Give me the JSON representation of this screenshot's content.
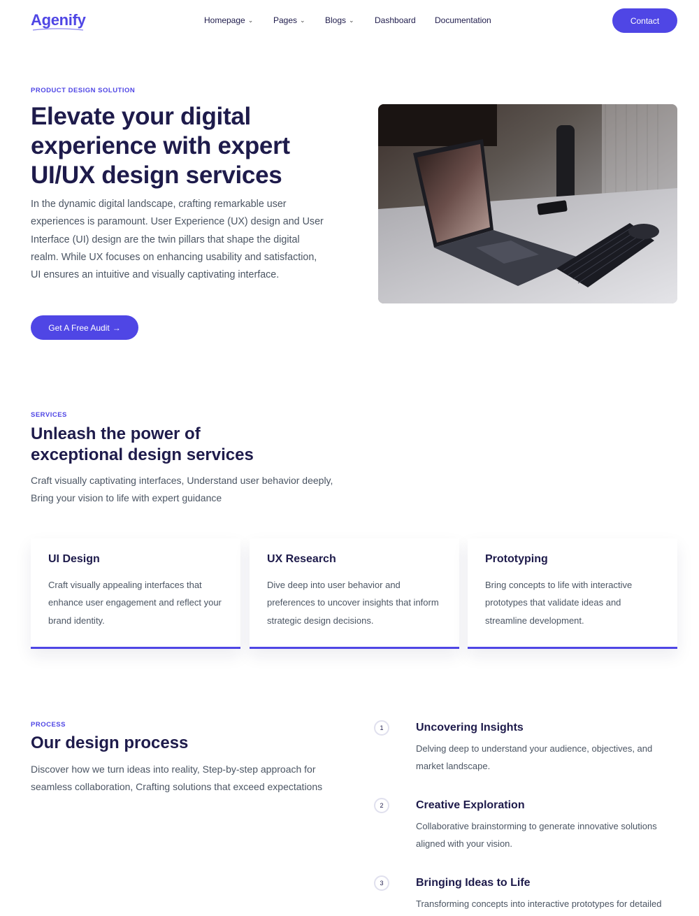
{
  "header": {
    "logo": "Agenify",
    "nav": [
      {
        "label": "Homepage",
        "has_dropdown": true
      },
      {
        "label": "Pages",
        "has_dropdown": true
      },
      {
        "label": "Blogs",
        "has_dropdown": true
      },
      {
        "label": "Dashboard",
        "has_dropdown": false
      },
      {
        "label": "Documentation",
        "has_dropdown": false
      }
    ],
    "contact_label": "Contact"
  },
  "hero": {
    "eyebrow": "PRODUCT DESIGN SOLUTION",
    "title": "Elevate your digital experience with expert UI/UX design services",
    "text": "In the dynamic digital landscape, crafting remarkable user experiences is paramount. User Experience (UX) design and User Interface (UI) design are the twin pillars that shape the digital realm. While UX focuses on enhancing usability and satisfaction, UI ensures an intuitive and visually captivating interface.",
    "cta_label": "Get A Free Audit",
    "cta_icon": "arrow-right-icon"
  },
  "services": {
    "eyebrow": "SERVICES",
    "title_line1": "Unleash the power of",
    "title_line2": "exceptional design services",
    "text_line1": "Craft visually captivating interfaces, Understand user behavior deeply,",
    "text_line2": "Bring your vision to life with expert guidance",
    "cards": [
      {
        "title": "UI Design",
        "text": "Craft visually appealing interfaces that enhance user engagement and reflect your brand identity."
      },
      {
        "title": "UX Research",
        "text": "Dive deep into user behavior and preferences to uncover insights that inform strategic design decisions."
      },
      {
        "title": "Prototyping",
        "text": "Bring concepts to life with interactive prototypes that validate ideas and streamline development."
      }
    ]
  },
  "process": {
    "eyebrow": "PROCESS",
    "title": "Our design process",
    "text": "Discover how we turn ideas into reality, Step-by-step approach for seamless collaboration, Crafting solutions that exceed expectations",
    "steps": [
      {
        "num": "1",
        "title": "Uncovering Insights",
        "text": "Delving deep to understand your audience, objectives, and market landscape."
      },
      {
        "num": "2",
        "title": "Creative Exploration",
        "text": "Collaborative brainstorming to generate innovative solutions aligned with your vision."
      },
      {
        "num": "3",
        "title": "Bringing Ideas to Life",
        "text": "Transforming concepts into interactive prototypes for detailed"
      }
    ]
  },
  "colors": {
    "accent": "#4f46e5",
    "heading": "#1e1b4b",
    "body_text": "#4b5563"
  }
}
